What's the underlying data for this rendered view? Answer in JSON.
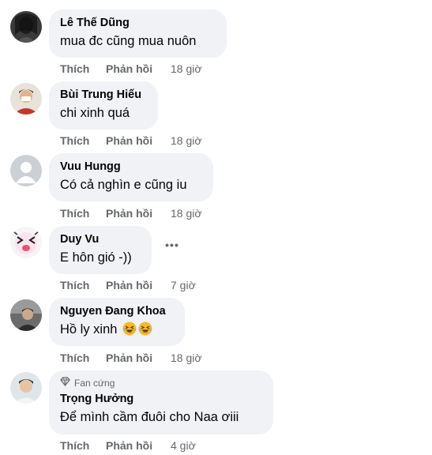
{
  "actions": {
    "like_label": "Thích",
    "reply_label": "Phản hồi"
  },
  "comments": [
    {
      "author": "Lê Thế Dũng",
      "text": "mua đc cũng mua nuôn",
      "time": "18 giờ"
    },
    {
      "author": "Bùi Trung Hiếu",
      "text": "chi xinh quá",
      "time": "18 giờ"
    },
    {
      "author": "Vuu Hungg",
      "text": "Có cả nghìn e cũng iu",
      "time": "18 giờ"
    },
    {
      "author": "Duy Vu",
      "text": "E hôn gió -))",
      "time": "7 giờ"
    },
    {
      "author": "Nguyen Đang Khoa",
      "text": "Hồ ly xinh",
      "emojis": [
        "laughing-face",
        "laughing-face"
      ],
      "time": "18 giờ"
    },
    {
      "author": "Trọng Hưởng",
      "badge": "Fan cứng",
      "text": "Để mình cầm đuôi cho Naa ơiii",
      "time": "4 giờ"
    }
  ],
  "more_options_label": "•••",
  "colors": {
    "bubble": "#f0f2f5",
    "meta": "#65676b",
    "text": "#050505"
  }
}
